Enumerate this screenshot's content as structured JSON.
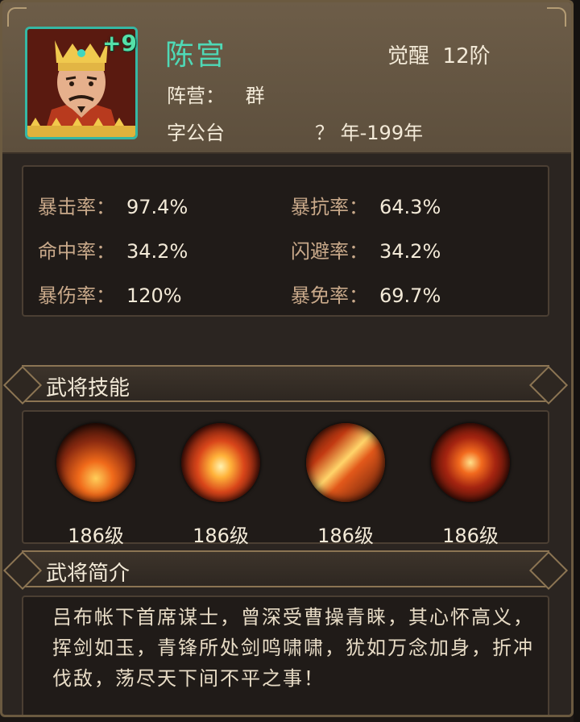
{
  "hero": {
    "name": "陈宫",
    "plus": "+9",
    "awaken_label": "觉醒",
    "awaken_value": "12阶",
    "faction_label": "阵营：",
    "faction_value": "群",
    "courtesy": "字公台",
    "lifespan": "？ 年-199年"
  },
  "stats": [
    {
      "label": "暴击率：",
      "value": "97.4%"
    },
    {
      "label": "暴抗率：",
      "value": "64.3%"
    },
    {
      "label": "命中率：",
      "value": "34.2%"
    },
    {
      "label": "闪避率：",
      "value": "34.2%"
    },
    {
      "label": "暴伤率：",
      "value": "120%"
    },
    {
      "label": "暴免率：",
      "value": "69.7%"
    }
  ],
  "skills_section": {
    "title": "武将技能",
    "skills": [
      {
        "icon": "fire-impact-skill-icon",
        "level": "186级"
      },
      {
        "icon": "fire-pillar-skill-icon",
        "level": "186级"
      },
      {
        "icon": "flame-sword-skill-icon",
        "level": "186级"
      },
      {
        "icon": "fire-slash-skill-icon",
        "level": "186级"
      }
    ]
  },
  "intro_section": {
    "title": "武将简介",
    "text": "吕布帐下首席谋士，曾深受曹操青睐，其心怀高义，挥剑如玉，青锋所处剑鸣啸啸，犹如万念加身，折冲伐敌，荡尽天下间不平之事！"
  },
  "colors": {
    "name": "#4fd9b6",
    "stat_label": "#c9a98a",
    "banner_border": "#8c7553",
    "portrait_border": "#35b7a4"
  }
}
